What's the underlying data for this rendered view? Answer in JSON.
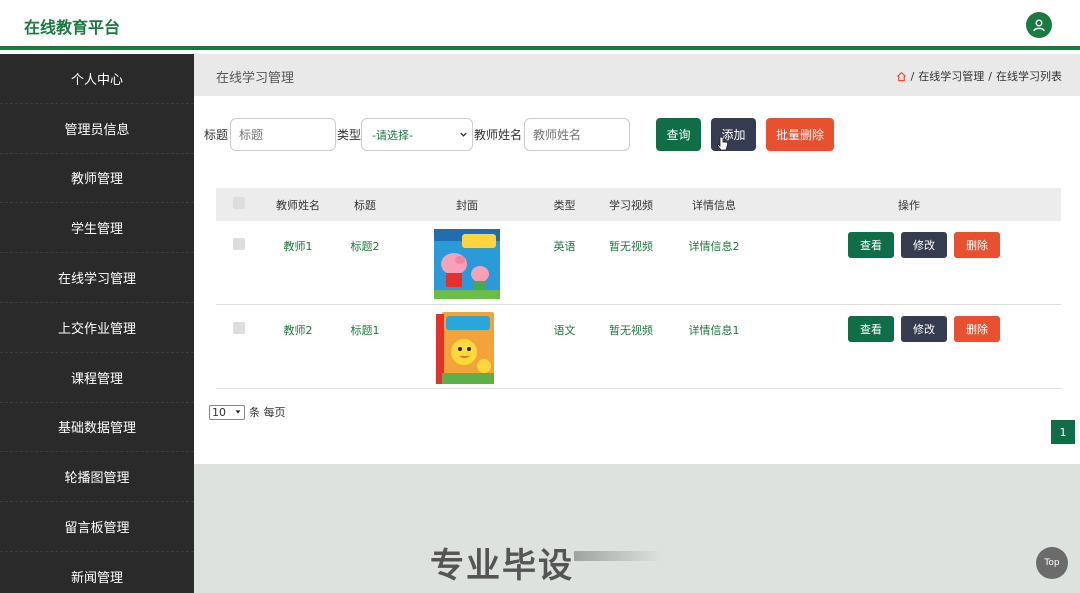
{
  "header": {
    "app_title": "在线教育平台",
    "avatar_icon": "user-icon"
  },
  "sidebar": {
    "items": [
      {
        "label": "个人中心"
      },
      {
        "label": "管理员信息"
      },
      {
        "label": "教师管理"
      },
      {
        "label": "学生管理"
      },
      {
        "label": "在线学习管理"
      },
      {
        "label": "上交作业管理"
      },
      {
        "label": "课程管理"
      },
      {
        "label": "基础数据管理"
      },
      {
        "label": "轮播图管理"
      },
      {
        "label": "留言板管理"
      },
      {
        "label": "新闻管理"
      }
    ]
  },
  "breadcrumb": {
    "page_title": "在线学习管理",
    "crumb1": "在线学习管理",
    "sep": "/",
    "crumb2": "在线学习列表"
  },
  "search": {
    "title_label": "标题",
    "title_placeholder": "标题",
    "type_label": "类型",
    "type_selected": "-请选择-",
    "teacher_label": "教师姓名",
    "teacher_placeholder": "教师姓名",
    "query_button": "查询",
    "add_button": "添加",
    "batch_delete_button": "批量删除"
  },
  "table": {
    "headers": [
      "教师姓名",
      "标题",
      "封面",
      "类型",
      "学习视频",
      "详情信息",
      "操作"
    ],
    "rows": [
      {
        "teacher": "教师1",
        "title": "标题2",
        "cover": "peppa-book",
        "type": "英语",
        "video": "暂无视频",
        "detail": "详情信息2"
      },
      {
        "teacher": "教师2",
        "title": "标题1",
        "cover": "duck-book",
        "type": "语文",
        "video": "暂无视频",
        "detail": "详情信息1"
      }
    ],
    "view_button": "查看",
    "edit_button": "修改",
    "delete_button": "删除"
  },
  "pagination": {
    "page_size": "10",
    "page_size_suffix": "条 每页",
    "current_page": "1"
  },
  "overlay": {
    "watermark": "专业毕设",
    "top_button": "Top"
  },
  "colors": {
    "primary": "#0f6e45",
    "dark": "#353c4f",
    "danger": "#e8502f",
    "sidebar": "#2a2a2a"
  }
}
